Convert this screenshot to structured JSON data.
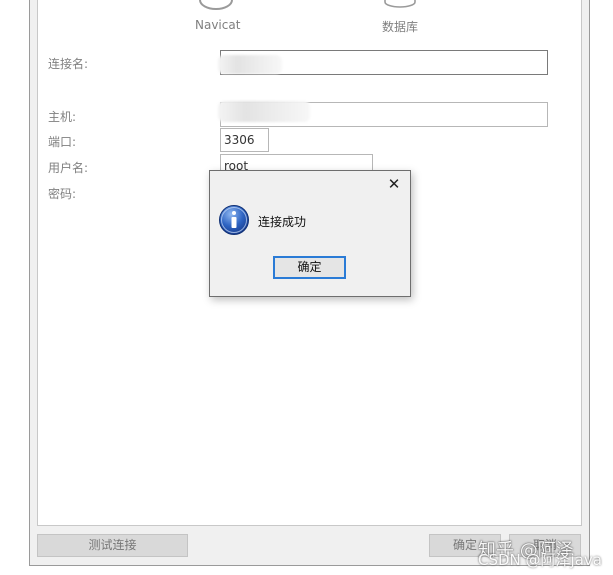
{
  "connection_types": [
    {
      "label": "Navicat",
      "icon": "navicat-icon"
    },
    {
      "label": "数据库",
      "icon": "database-icon"
    }
  ],
  "form": {
    "connection_name_label": "连接名:",
    "host_label": "主机:",
    "port_label": "端口:",
    "port_value": "3306",
    "username_label": "用户名:",
    "username_value": "root",
    "password_label": "密码:"
  },
  "buttons": {
    "test_connection": "测试连接",
    "ok": "确定",
    "cancel": "取消"
  },
  "dialog": {
    "message": "连接成功",
    "ok_label": "确定",
    "close_glyph": "✕",
    "icon": "info-icon"
  },
  "watermark": {
    "text": "知乎 @阿泽",
    "csdn_text": "CSDN @阿泽java"
  },
  "colors": {
    "dialog_ok_border": "#2a7bd6",
    "info_icon_blue": "#1d4fa8"
  }
}
